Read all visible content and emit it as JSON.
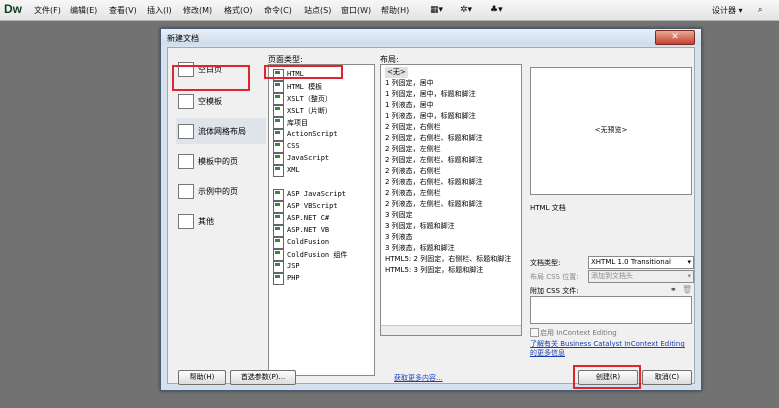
{
  "app": {
    "logo": "Dw"
  },
  "menu": [
    "文件(F)",
    "编辑(E)",
    "查看(V)",
    "插入(I)",
    "修改(M)",
    "格式(O)",
    "命令(C)",
    "站点(S)",
    "窗口(W)",
    "帮助(H)"
  ],
  "toolbar": {
    "layout_icon": "layout-icon",
    "gear_icon": "gear-icon",
    "site_icon": "site-icon",
    "workspace_label": "设计器"
  },
  "dialog": {
    "title": "新建文档",
    "close": "✕",
    "categories": [
      {
        "label": "空白页",
        "icon": "blank-page-icon"
      },
      {
        "label": "空模板",
        "icon": "blank-template-icon"
      },
      {
        "label": "流体网格布局",
        "icon": "fluid-grid-icon"
      },
      {
        "label": "模板中的页",
        "icon": "template-page-icon"
      },
      {
        "label": "示例中的页",
        "icon": "sample-page-icon"
      },
      {
        "label": "其他",
        "icon": "other-icon"
      }
    ],
    "page_type_header": "页面类型:",
    "page_types": [
      "HTML",
      "HTML 模板",
      "XSLT（整页）",
      "XSLT（片断）",
      "库项目",
      "ActionScript",
      "CSS",
      "JavaScript",
      "XML",
      "",
      "ASP JavaScript",
      "ASP VBScript",
      "ASP.NET C#",
      "ASP.NET VB",
      "ColdFusion",
      "ColdFusion 组件",
      "JSP",
      "PHP"
    ],
    "layout_header": "布局:",
    "layouts": [
      "<无>",
      "1 列固定，居中",
      "1 列固定，居中，标题和脚注",
      "1 列液态，居中",
      "1 列液态，居中，标题和脚注",
      "2 列固定，右侧栏",
      "2 列固定，右侧栏、标题和脚注",
      "2 列固定，左侧栏",
      "2 列固定，左侧栏、标题和脚注",
      "2 列液态，右侧栏",
      "2 列液态，右侧栏、标题和脚注",
      "2 列液态，左侧栏",
      "2 列液态，左侧栏、标题和脚注",
      "3 列固定",
      "3 列固定，标题和脚注",
      "3 列液态",
      "3 列液态，标题和脚注",
      "HTML5: 2 列固定，右侧栏、标题和脚注",
      "HTML5: 3 列固定，标题和脚注"
    ],
    "preview_text": "<无预览>",
    "description": "HTML 文档",
    "doctype_label": "文档类型:",
    "doctype_value": "XHTML 1.0 Transitional",
    "layout_css_label": "布局 CSS 位置:",
    "layout_css_value": "添加到文档头",
    "attach_css_label": "附加 CSS 文件:",
    "incontext_label": "启用 InContext Editing",
    "learn_more_link": "了解有关 Business Catalyst InContext Editing 的更多信息",
    "help_button": "帮助(H)",
    "prefs_button": "首选参数(P)...",
    "get_more_link": "获取更多内容...",
    "create_button": "创建(R)",
    "cancel_button": "取消(C)"
  }
}
